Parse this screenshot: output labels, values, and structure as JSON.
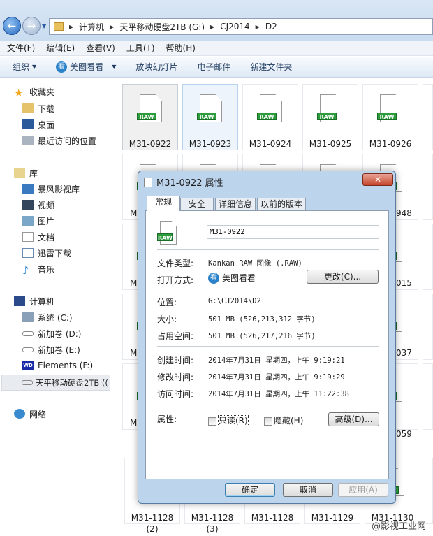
{
  "explorer": {
    "breadcrumb": [
      "计算机",
      "天平移动硬盘2TB (G:)",
      "CJ2014",
      "D2"
    ],
    "menu": [
      "文件(F)",
      "编辑(E)",
      "查看(V)",
      "工具(T)",
      "帮助(H)"
    ],
    "toolbar": {
      "organize": "组织",
      "open_with": "美图看看",
      "slideshow": "放映幻灯片",
      "email": "电子邮件",
      "new_folder": "新建文件夹"
    },
    "sidebar": {
      "favorites": "收藏夹",
      "fav_items": [
        "下载",
        "桌面",
        "最近访问的位置"
      ],
      "libraries": "库",
      "lib_items": [
        "暴风影视库",
        "视频",
        "图片",
        "文档",
        "迅雷下载",
        "音乐"
      ],
      "computer": "计算机",
      "drives": [
        "系统 (C:)",
        "新加卷 (D:)",
        "新加卷 (E:)",
        "Elements (F:)",
        "天平移动硬盘2TB (("
      ],
      "network": "网络"
    },
    "files_top": [
      "M31-0922",
      "M31-0923",
      "M31-0924",
      "M31-0925",
      "M31-0926"
    ],
    "files_bottom": [
      [
        "M31-1128",
        "(2)"
      ],
      [
        "M31-1128",
        "(3)"
      ],
      [
        "M31-1128",
        ""
      ],
      [
        "M31-1129",
        ""
      ],
      [
        "M31-1130",
        ""
      ]
    ],
    "partial_labels_right": [
      "948",
      "015",
      "037",
      "059"
    ],
    "partial_labels_left": "M",
    "file_badge": "RAW"
  },
  "dialog": {
    "title": "M31-0922 属性",
    "tabs": [
      "常规",
      "安全",
      "详细信息",
      "以前的版本"
    ],
    "filename": "M31-0922",
    "file_type_label": "文件类型:",
    "file_type": "Kankan RAW 图像 (.RAW)",
    "open_with_label": "打开方式:",
    "open_with": "美图看看",
    "change_button": "更改(C)...",
    "location_label": "位置:",
    "location": "G:\\CJ2014\\D2",
    "size_label": "大小:",
    "size": "501 MB (526,213,312 字节)",
    "disk_size_label": "占用空间:",
    "disk_size": "501 MB (526,217,216 字节)",
    "created_label": "创建时间:",
    "created": "2014年7月31日 星期四，上午 9:19:21",
    "modified_label": "修改时间:",
    "modified": "2014年7月31日 星期四，上午 9:19:29",
    "accessed_label": "访问时间:",
    "accessed": "2014年7月31日 星期四，上午 11:22:38",
    "attributes_label": "属性:",
    "readonly": "只读(R)",
    "readonly_checked": false,
    "hidden": "隐藏(H)",
    "hidden_checked": false,
    "advanced_button": "高级(D)...",
    "ok": "确定",
    "cancel": "取消",
    "apply": "应用(A)"
  },
  "watermark": "@影视工业网"
}
